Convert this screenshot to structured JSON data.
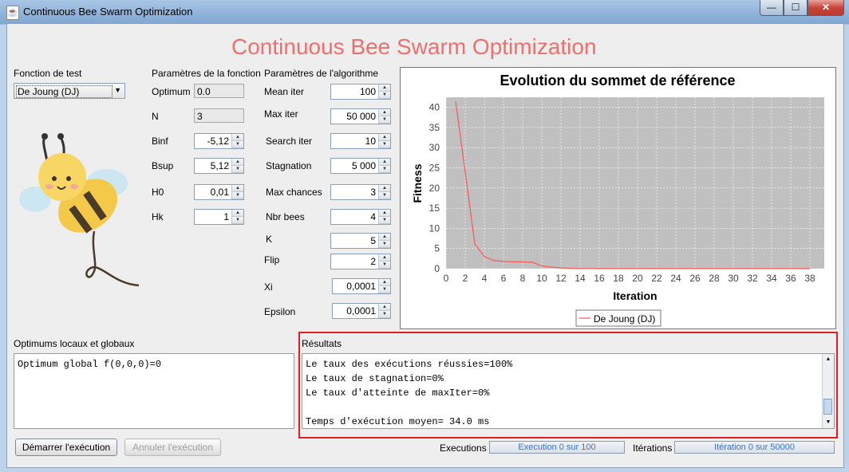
{
  "window": {
    "title": "Continuous Bee Swarm Optimization",
    "controls": {
      "minimize": "—",
      "maximize": "☐",
      "close": "✕"
    }
  },
  "app_title": "Continuous Bee Swarm Optimization",
  "test_function": {
    "label": "Fonction de test",
    "selected": "De Joung (DJ)"
  },
  "function_params": {
    "heading": "Paramètres de la fonction",
    "optimum": {
      "label": "Optimum",
      "value": "0.0"
    },
    "n": {
      "label": "N",
      "value": "3"
    },
    "binf": {
      "label": "Binf",
      "value": "-5,12"
    },
    "bsup": {
      "label": "Bsup",
      "value": "5,12"
    },
    "h0": {
      "label": "H0",
      "value": "0,01"
    },
    "hk": {
      "label": "Hk",
      "value": "1"
    }
  },
  "algo_params": {
    "heading": "Paramètres de l'algorithme",
    "mean_iter": {
      "label": "Mean iter",
      "value": "100"
    },
    "max_iter": {
      "label": "Max iter",
      "value": "50 000"
    },
    "search_iter": {
      "label": "Search iter",
      "value": "10"
    },
    "stagnation": {
      "label": "Stagnation",
      "value": "5 000"
    },
    "max_chances": {
      "label": "Max chances",
      "value": "3"
    },
    "nbr_bees": {
      "label": "Nbr bees",
      "value": "4"
    },
    "k": {
      "label": "K",
      "value": "5"
    },
    "flip": {
      "label": "Flip",
      "value": "2"
    },
    "xi": {
      "label": "Xi",
      "value": "0,0001"
    },
    "epsilon": {
      "label": "Epsilon",
      "value": "0,0001"
    }
  },
  "chart_data": {
    "type": "line",
    "title": "Evolution du sommet de référence",
    "xlabel": "Iteration",
    "ylabel": "Fitness",
    "xlim": [
      0,
      39.5
    ],
    "ylim": [
      0,
      42.5
    ],
    "xticks": [
      0,
      2,
      4,
      6,
      8,
      10,
      12,
      14,
      16,
      18,
      20,
      22,
      24,
      26,
      28,
      30,
      32,
      34,
      36,
      38
    ],
    "yticks": [
      0,
      5,
      10,
      15,
      20,
      25,
      30,
      35,
      40
    ],
    "grid": true,
    "legend": "bottom",
    "series": [
      {
        "name": "De Joung (DJ)",
        "color": "#ff5555",
        "x": [
          1,
          2,
          3,
          4,
          5,
          6,
          7,
          8,
          9,
          10,
          11,
          12,
          13,
          14,
          15,
          16,
          17,
          18,
          19,
          20,
          21,
          22,
          23,
          24,
          25,
          26,
          27,
          28,
          29,
          30,
          31,
          32,
          33,
          34,
          35,
          36,
          37,
          38
        ],
        "values": [
          41.5,
          24,
          6.2,
          3.0,
          2.0,
          1.8,
          1.7,
          1.7,
          1.6,
          0.7,
          0.4,
          0.2,
          0.1,
          0.05,
          0.03,
          0.02,
          0.01,
          0.01,
          0.01,
          0.01,
          0.01,
          0.01,
          0.01,
          0.01,
          0.01,
          0.01,
          0.01,
          0.01,
          0.01,
          0.01,
          0.01,
          0.01,
          0.01,
          0.01,
          0.01,
          0.01,
          0.01,
          0.01
        ]
      }
    ]
  },
  "optimums": {
    "label": "Optimums locaux et globaux",
    "text": "Optimum global f(0,0,0)=0"
  },
  "results": {
    "label": "Résultats",
    "lines": [
      "Le taux des exécutions réussies=100%",
      "Le taux de stagnation=0%",
      "Le taux d'atteinte de maxIter=0%",
      "",
      "Temps d'exécution moyen= 34.0 ms"
    ]
  },
  "buttons": {
    "start": "Démarrer l'exécution",
    "cancel": "Annuler l'exécution"
  },
  "executions": {
    "label": "Executions",
    "progress_text": "Execution 0 sur 100",
    "progress": 0
  },
  "iterations": {
    "label": "Itérations",
    "progress_text": "Itération 0 sur 50000",
    "progress": 0
  }
}
